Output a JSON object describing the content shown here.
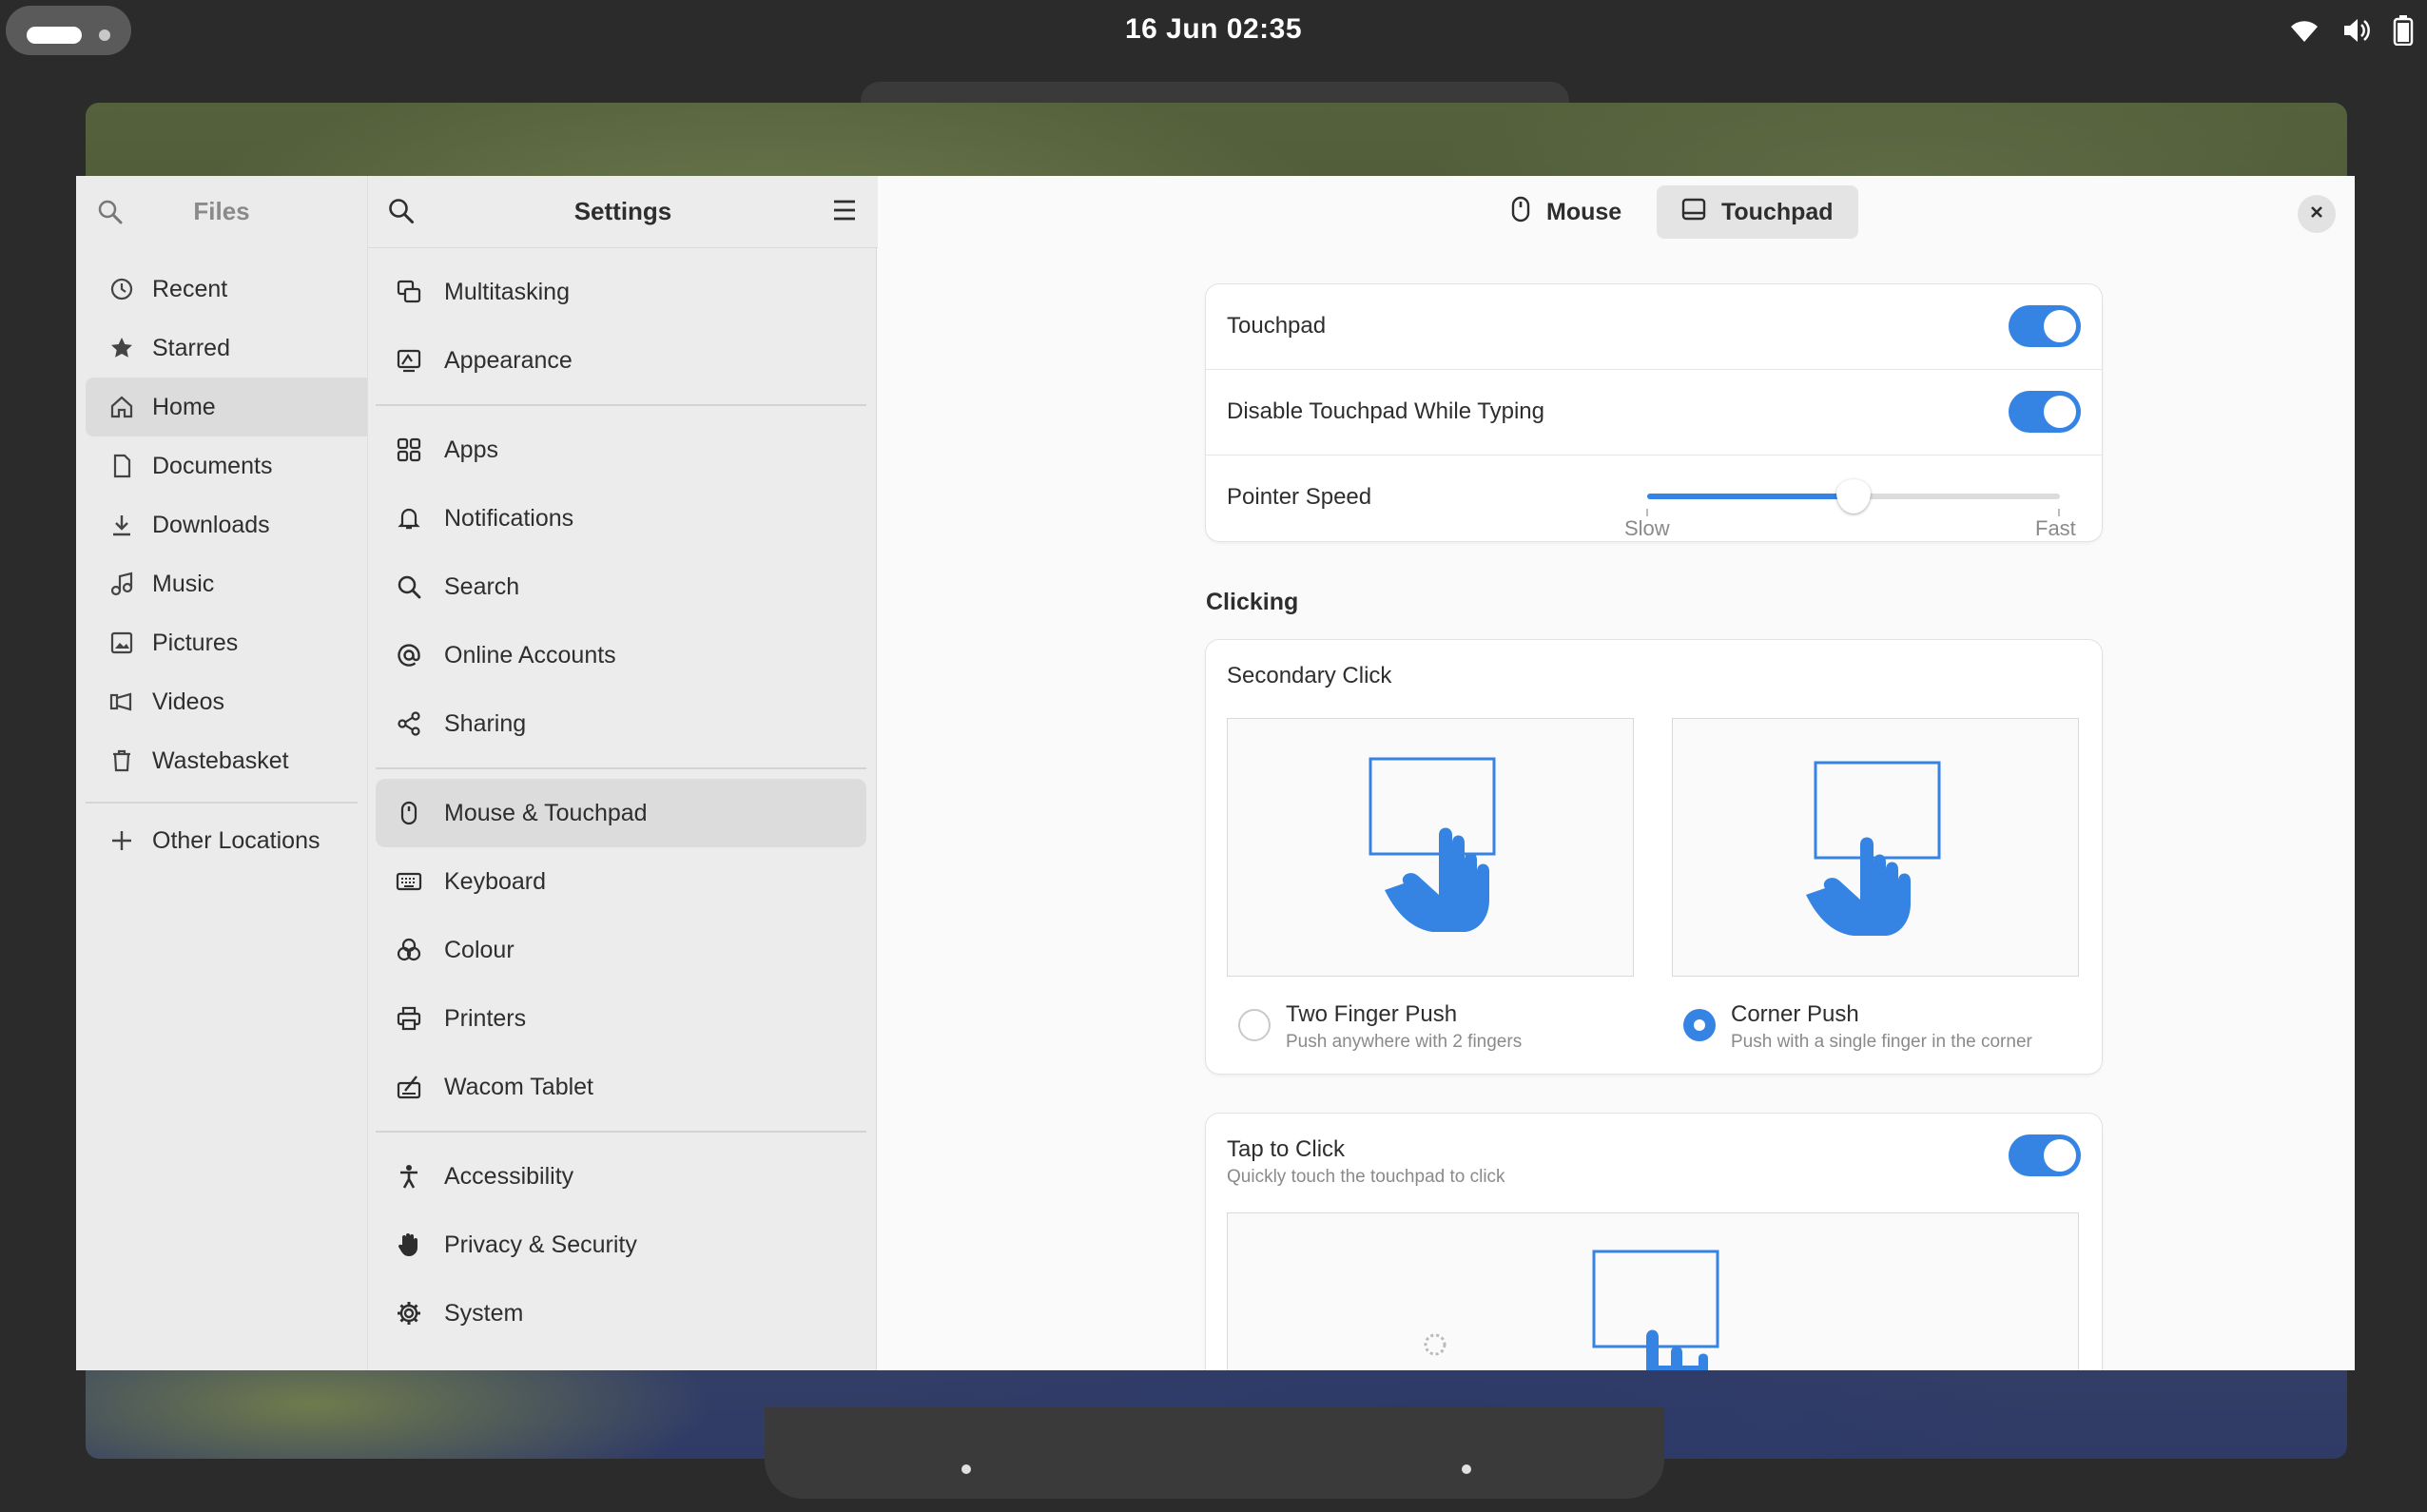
{
  "topbar": {
    "clock": "16 Jun  02:35",
    "tray_icons": [
      "wifi-icon",
      "volume-icon",
      "battery-icon"
    ]
  },
  "files": {
    "title": "Files",
    "items": [
      {
        "label": "Recent",
        "icon": "clock-icon"
      },
      {
        "label": "Starred",
        "icon": "star-icon"
      },
      {
        "label": "Home",
        "icon": "home-icon",
        "active": true
      },
      {
        "label": "Documents",
        "icon": "document-icon"
      },
      {
        "label": "Downloads",
        "icon": "download-icon"
      },
      {
        "label": "Music",
        "icon": "music-icon"
      },
      {
        "label": "Pictures",
        "icon": "picture-icon"
      },
      {
        "label": "Videos",
        "icon": "video-icon"
      },
      {
        "label": "Wastebasket",
        "icon": "trash-icon"
      }
    ],
    "other_locations": "Other Locations"
  },
  "settings": {
    "title": "Settings",
    "groups": [
      [
        {
          "label": "Multitasking",
          "icon": "multitasking-icon"
        },
        {
          "label": "Appearance",
          "icon": "appearance-icon"
        }
      ],
      [
        {
          "label": "Apps",
          "icon": "apps-icon"
        },
        {
          "label": "Notifications",
          "icon": "bell-icon"
        },
        {
          "label": "Search",
          "icon": "search-icon"
        },
        {
          "label": "Online Accounts",
          "icon": "at-icon"
        },
        {
          "label": "Sharing",
          "icon": "share-icon"
        }
      ],
      [
        {
          "label": "Mouse & Touchpad",
          "icon": "mouse-icon",
          "active": true
        },
        {
          "label": "Keyboard",
          "icon": "keyboard-icon"
        },
        {
          "label": "Colour",
          "icon": "colour-icon"
        },
        {
          "label": "Printers",
          "icon": "printer-icon"
        },
        {
          "label": "Wacom Tablet",
          "icon": "tablet-icon"
        }
      ],
      [
        {
          "label": "Accessibility",
          "icon": "accessibility-icon"
        },
        {
          "label": "Privacy & Security",
          "icon": "hand-icon"
        },
        {
          "label": "System",
          "icon": "gear-icon"
        }
      ]
    ]
  },
  "content": {
    "tabs": {
      "mouse": "Mouse",
      "touchpad": "Touchpad",
      "active": "touchpad"
    },
    "touchpad_card": {
      "touchpad_label": "Touchpad",
      "touchpad_on": true,
      "disable_typing_label": "Disable Touchpad While Typing",
      "disable_typing_on": true,
      "pointer_speed_label": "Pointer Speed",
      "pointer_speed_value": 0.5,
      "slow_label": "Slow",
      "fast_label": "Fast"
    },
    "clicking": {
      "section_title": "Clicking",
      "secondary_click_title": "Secondary Click",
      "options": [
        {
          "title": "Two Finger Push",
          "subtitle": "Push anywhere with 2 fingers",
          "selected": false
        },
        {
          "title": "Corner Push",
          "subtitle": "Push with a single finger in the corner",
          "selected": true
        }
      ]
    },
    "tap_to_click": {
      "title": "Tap to Click",
      "subtitle": "Quickly touch the touchpad to click",
      "on": true
    }
  },
  "colors": {
    "accent": "#3584e4",
    "window_bg": "#fafafa",
    "sidebar_bg": "#ebebeb",
    "topbar_bg": "#2b2b2b"
  }
}
